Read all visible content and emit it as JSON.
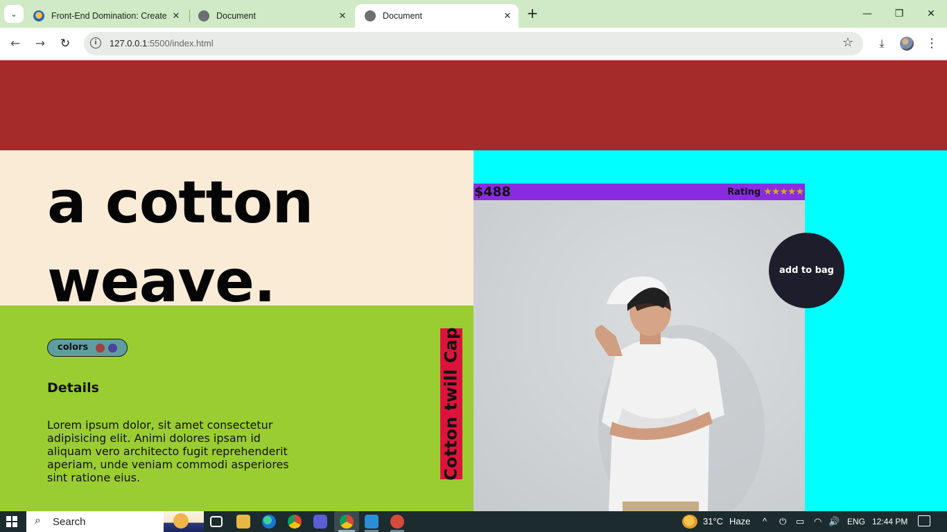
{
  "browser": {
    "tabs": [
      {
        "title": "Front-End Domination: Create A",
        "close": "✕"
      },
      {
        "title": "Document",
        "close": "✕"
      },
      {
        "title": "Document",
        "close": "✕",
        "active": true
      }
    ],
    "new_tab": "+",
    "window_controls": {
      "minimize": "—",
      "maximize": "❐",
      "close": "✕"
    },
    "nav": {
      "back": "←",
      "forward": "→",
      "reload": "↻"
    },
    "url_host": "127.0.0.1",
    "url_rest": ":5500/index.html",
    "icons": {
      "info": "i",
      "bookmark": "☆",
      "download": "⤓",
      "menu": "⋮",
      "tab_search": "⌄"
    }
  },
  "page": {
    "colors": {
      "top_band": "#a52a2a",
      "cream": "#faebd7",
      "green": "#9acd32",
      "cyan": "#00ffff",
      "card_bar": "#8a2be2",
      "label_bg": "#dc143c",
      "button_bg": "#1e1d2b"
    },
    "hero_line1": "a cotton",
    "hero_line2": "weave.",
    "colors_label": "colors",
    "swatches": [
      "#a0413f",
      "#4c4599"
    ],
    "details_title": "Details",
    "details_text": "Lorem ipsum dolor, sit amet consectetur adipisicing elit. Animi dolores ipsam id aliquam vero architecto fugit reprehenderit aperiam, unde veniam commodi asperiores sint ratione eius.",
    "vertical_label": "Cotton twill Cap",
    "price": "$488",
    "rating_label": "Rating",
    "rating_stars": "★★★★★",
    "rating_value": 5,
    "add_to_bag": "add to bag"
  },
  "taskbar": {
    "search": "Search",
    "weather": "31°C",
    "weather_desc": "Haze",
    "lang": "ENG",
    "time": "12:44 PM",
    "tray_icons": [
      "^",
      "⏻",
      "▭",
      "◠",
      "🔊"
    ]
  }
}
